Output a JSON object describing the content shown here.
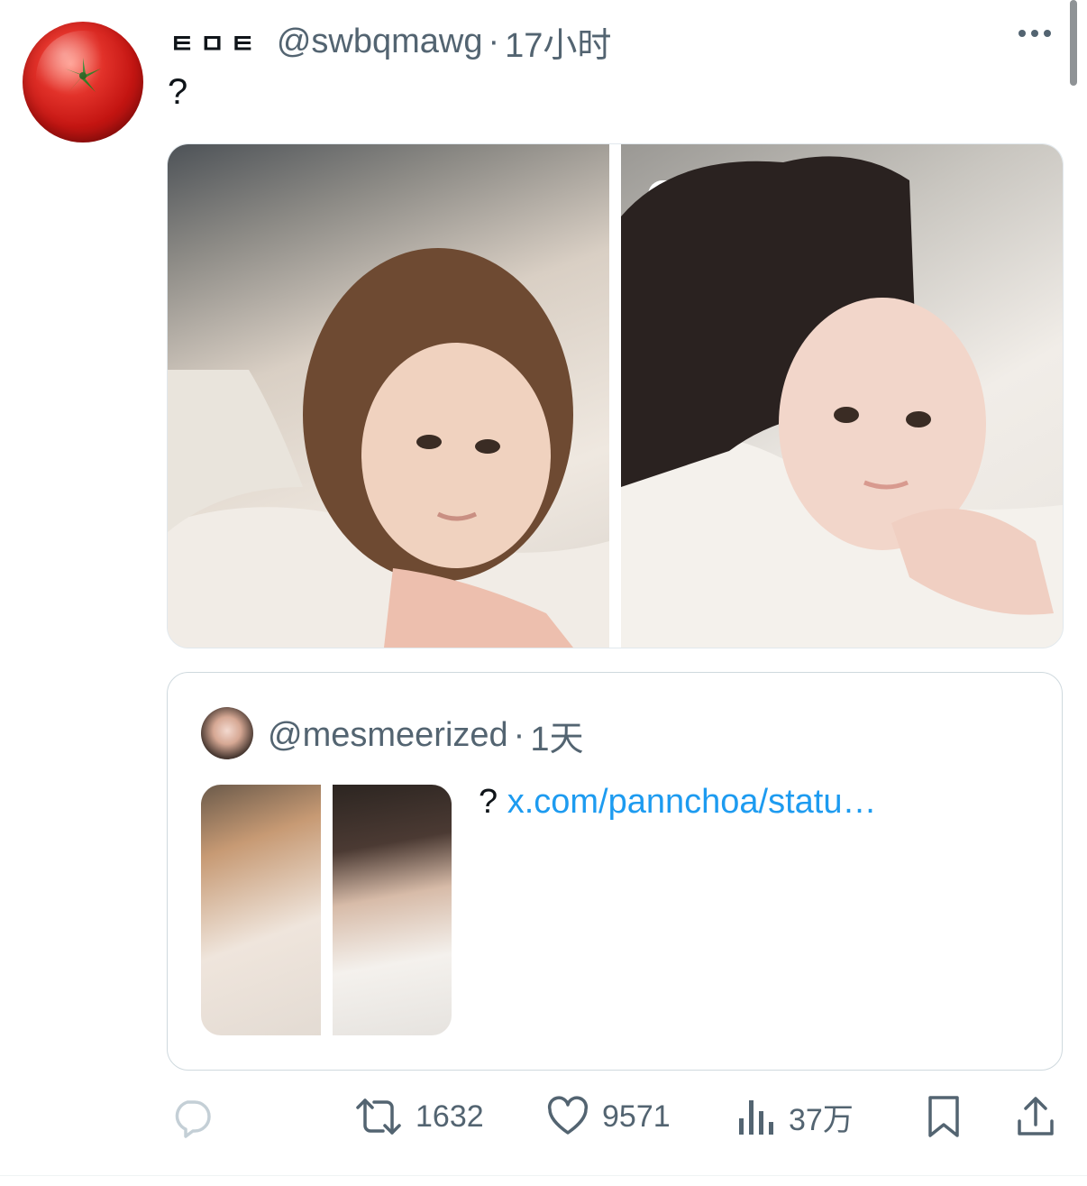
{
  "tweet": {
    "display_name": "ㅌㅁㅌ",
    "handle": "@swbqmawg",
    "separator": "·",
    "time": "17小时",
    "text": "?"
  },
  "quoted": {
    "handle": "@mesmeerized",
    "separator": "·",
    "time": "1天",
    "text_prefix": "?",
    "link": "x.com/pannchoa/statu…"
  },
  "actions": {
    "reply_count": "",
    "retweet_count": "1632",
    "like_count": "9571",
    "views_count": "37万"
  },
  "colors": {
    "text_primary": "#0f1419",
    "text_secondary": "#536471",
    "link": "#1d9bf0",
    "border": "#cfd9de",
    "avatar_red": "#c41512"
  },
  "icons": [
    "more-icon",
    "reply-icon",
    "retweet-icon",
    "like-icon",
    "views-icon",
    "bookmark-icon",
    "share-icon"
  ]
}
